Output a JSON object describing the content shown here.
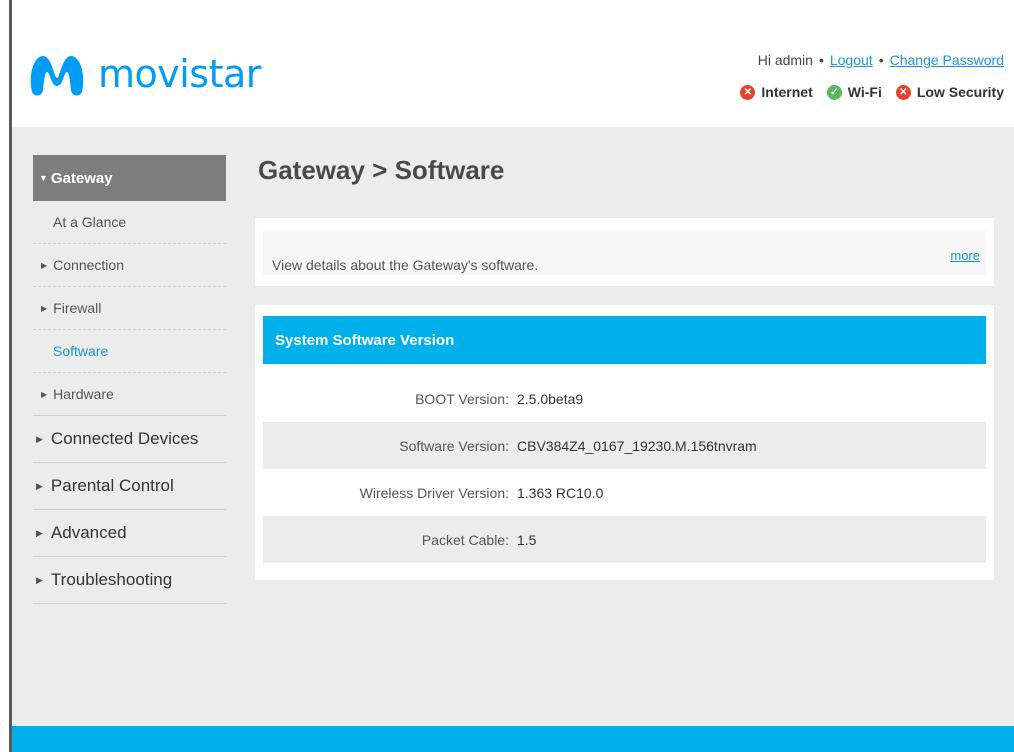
{
  "brand": {
    "name": "movistar",
    "color": "#019df4"
  },
  "header": {
    "greeting": "Hi admin",
    "logout_label": "Logout",
    "change_password_label": "Change Password",
    "separator": "•",
    "status": [
      {
        "label": "Internet",
        "state": "error",
        "color": "#e2442f",
        "icon": "x-circle-icon"
      },
      {
        "label": "Wi-Fi",
        "state": "ok",
        "color": "#5cb85c",
        "icon": "check-circle-icon"
      },
      {
        "label": "Low Security",
        "state": "error",
        "color": "#e2442f",
        "icon": "x-circle-icon"
      }
    ]
  },
  "sidebar": {
    "active_section": "Gateway",
    "sub_items": [
      {
        "label": "At a Glance",
        "has_arrow": false,
        "current": false
      },
      {
        "label": "Connection",
        "has_arrow": true,
        "current": false
      },
      {
        "label": "Firewall",
        "has_arrow": true,
        "current": false
      },
      {
        "label": "Software",
        "has_arrow": false,
        "current": true
      },
      {
        "label": "Hardware",
        "has_arrow": true,
        "current": false
      }
    ],
    "top_items": [
      {
        "label": "Connected Devices"
      },
      {
        "label": "Parental Control"
      },
      {
        "label": "Advanced"
      },
      {
        "label": "Troubleshooting"
      }
    ]
  },
  "main": {
    "title": "Gateway > Software",
    "info_text": "View details about the Gateway's software.",
    "more_label": "more",
    "section_title": "System Software Version",
    "rows": [
      {
        "label": "BOOT Version:",
        "value": "2.5.0beta9"
      },
      {
        "label": "Software Version:",
        "value": "CBV384Z4_0167_19230.M.156tnvram"
      },
      {
        "label": "Wireless Driver Version:",
        "value": "1.363 RC10.0"
      },
      {
        "label": "Packet Cable:",
        "value": "1.5"
      }
    ]
  },
  "colors": {
    "accent": "#00b0eb",
    "link": "#1a97d5",
    "sidebar_active": "#7d7d7d"
  }
}
